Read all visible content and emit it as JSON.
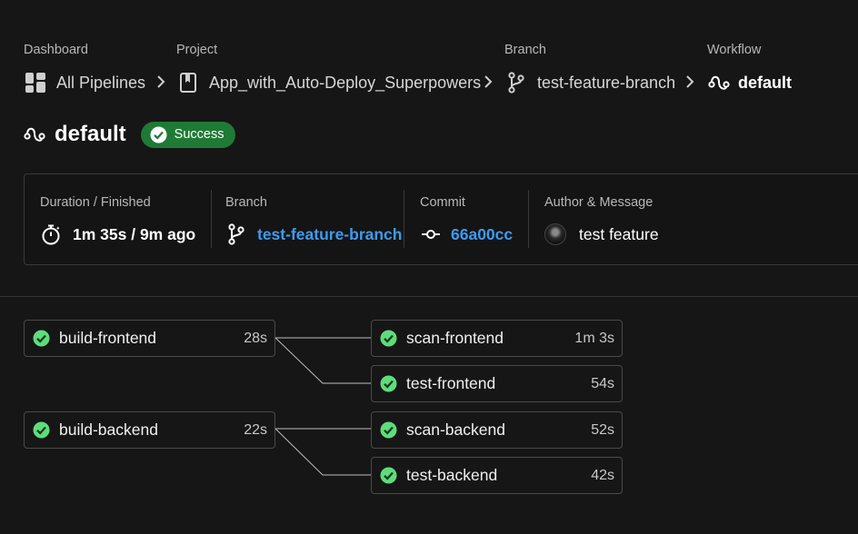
{
  "breadcrumbs": [
    {
      "caption": "Dashboard",
      "label": "All Pipelines",
      "icon": "dashboard-grid-icon"
    },
    {
      "caption": "Project",
      "label": "App_with_Auto-Deploy_Superpowers",
      "icon": "project-bookmark-icon"
    },
    {
      "caption": "Branch",
      "label": "test-feature-branch",
      "icon": "git-branch-icon"
    },
    {
      "caption": "Workflow",
      "label": "default",
      "icon": "workflow-icon"
    }
  ],
  "workflow": {
    "title": "default",
    "status": "Success",
    "status_color": "#1f7a35"
  },
  "summary": {
    "duration": {
      "caption": "Duration / Finished",
      "value": "1m 35s / 9m ago",
      "icon": "stopwatch-icon"
    },
    "branch": {
      "caption": "Branch",
      "value": "test-feature-branch",
      "icon": "git-branch-icon"
    },
    "commit": {
      "caption": "Commit",
      "value": "66a00cc",
      "icon": "git-commit-icon"
    },
    "author": {
      "caption": "Author & Message",
      "value": "test feature",
      "icon": "avatar"
    }
  },
  "jobs": [
    {
      "name": "build-frontend",
      "duration": "28s",
      "status": "success"
    },
    {
      "name": "scan-frontend",
      "duration": "1m 3s",
      "status": "success"
    },
    {
      "name": "test-frontend",
      "duration": "54s",
      "status": "success"
    },
    {
      "name": "build-backend",
      "duration": "22s",
      "status": "success"
    },
    {
      "name": "scan-backend",
      "duration": "52s",
      "status": "success"
    },
    {
      "name": "test-backend",
      "duration": "42s",
      "status": "success"
    }
  ],
  "colors": {
    "link": "#3d9bf0",
    "success_icon": "#5fdc7c",
    "background": "#161616"
  }
}
